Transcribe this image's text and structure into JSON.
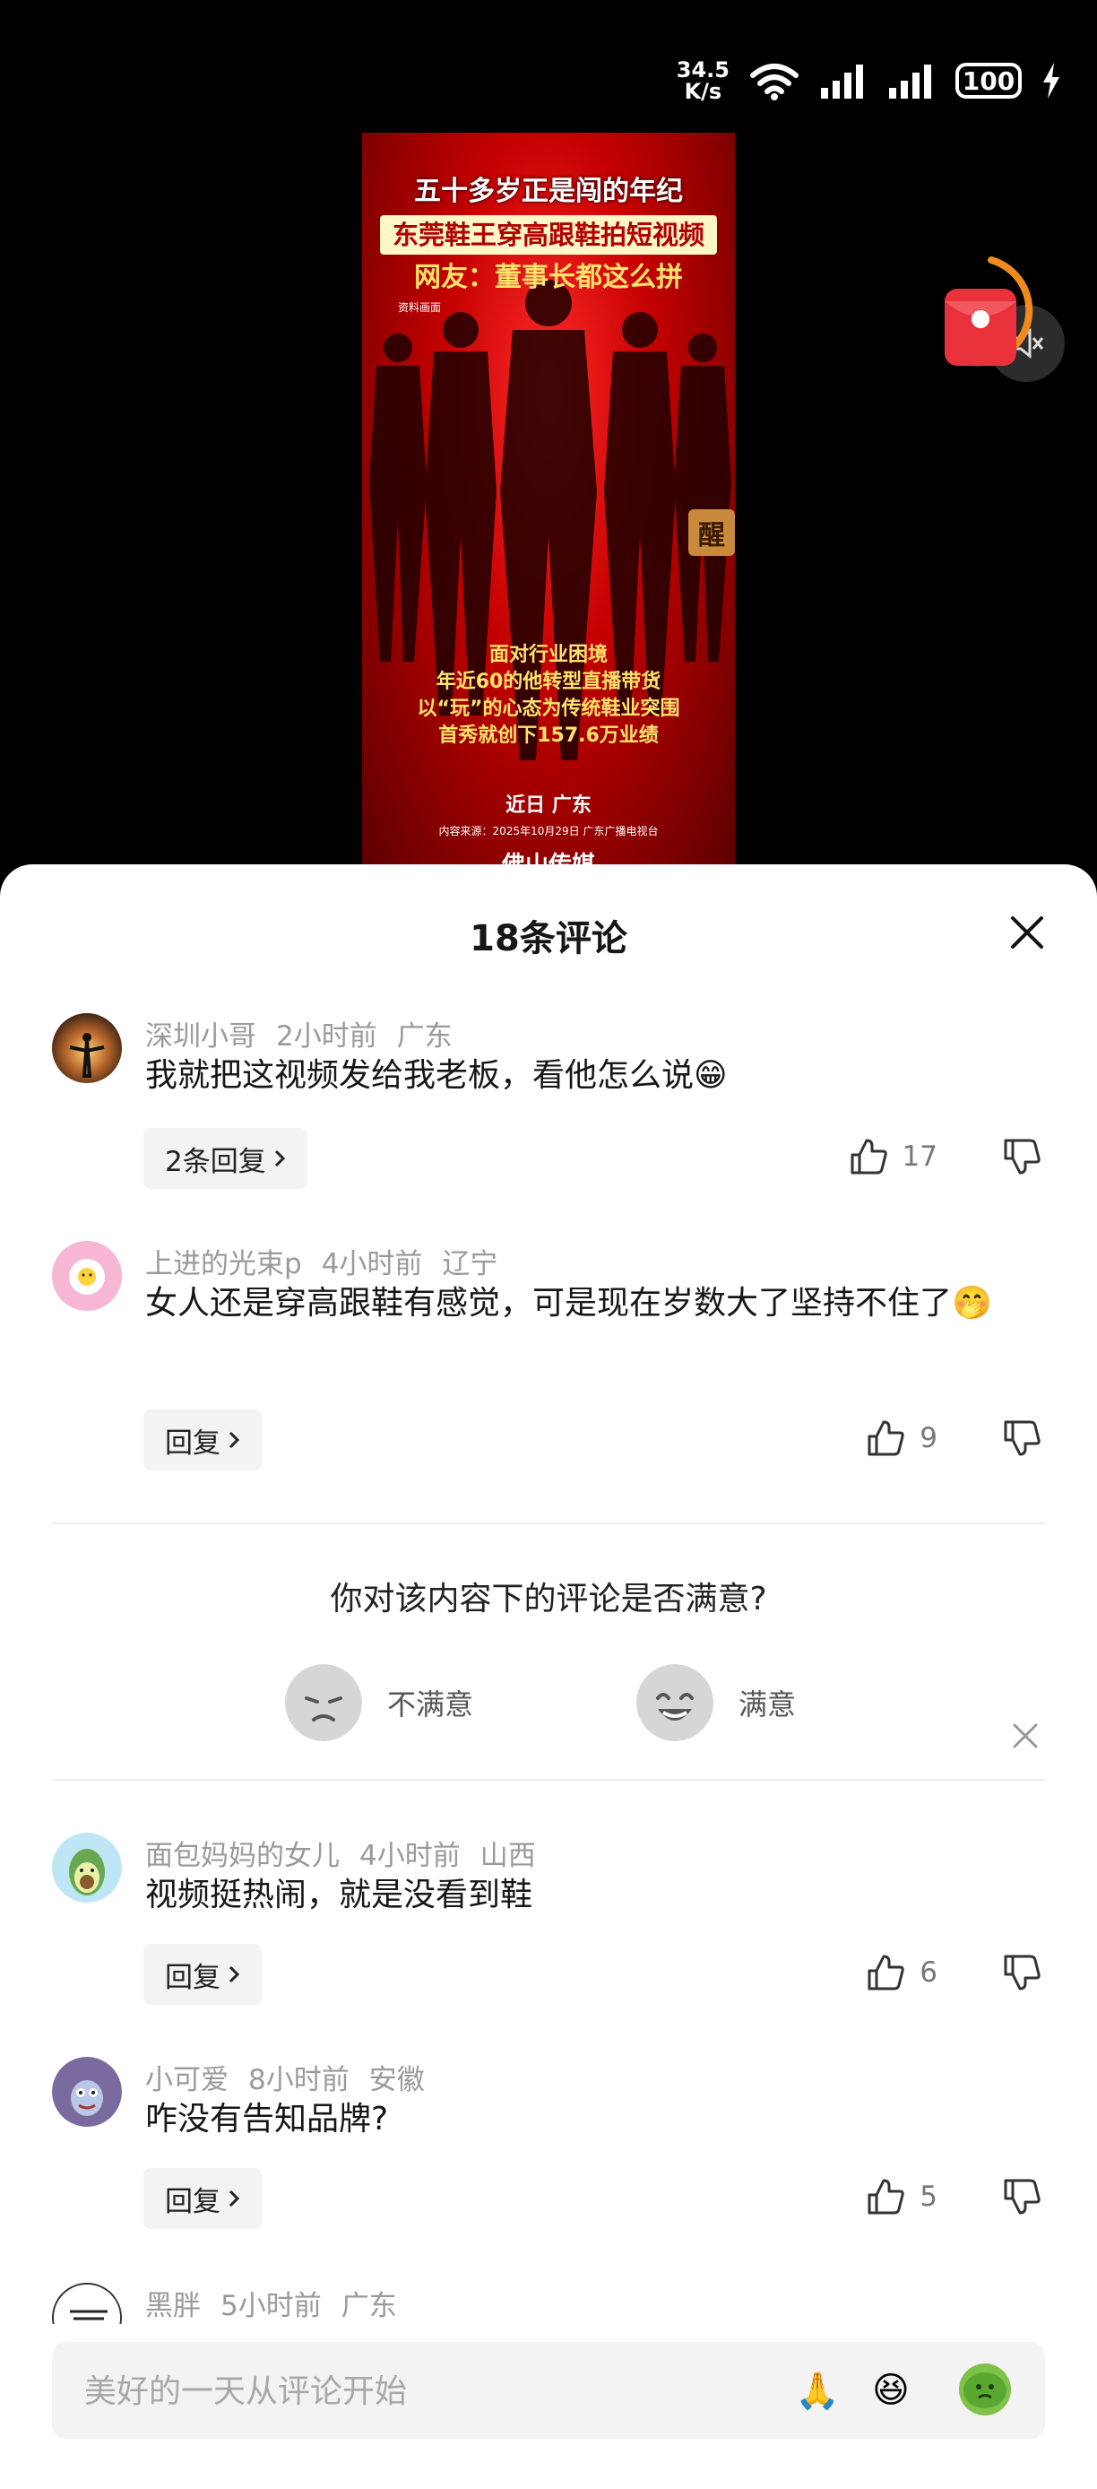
{
  "status_bar": {
    "speed_value": "34.5",
    "speed_unit": "K/s",
    "battery": "100"
  },
  "video": {
    "title_line1": "五十多岁正是闯的年纪",
    "title_line2": "东莞鞋王穿高跟鞋拍短视频",
    "title_line3": "网友：董事长都这么拼",
    "small_caption": "资料画面",
    "sub_lines": [
      "面对行业困境",
      "年近60的他转型直播带货",
      "以“玩”的心态为传统鞋业突围",
      "首秀就创下157.6万业绩"
    ],
    "place": "近日 广东",
    "source": "内容来源：2025年10月29日 广东广播电视台",
    "logo": "佛山传媒",
    "stamp": "醒"
  },
  "sheet": {
    "title": "18条评论"
  },
  "comments": [
    {
      "user": "深圳小哥",
      "time": "2小时前",
      "location": "广东",
      "text": "我就把这视频发给我老板，看他怎么说😁",
      "reply_label": "2条回复",
      "likes": "17"
    },
    {
      "user": "上进的光束p",
      "time": "4小时前",
      "location": "辽宁",
      "text": "女人还是穿高跟鞋有感觉，可是现在岁数大了坚持不住了🤭",
      "reply_label": "回复",
      "likes": "9"
    },
    {
      "user": "面包妈妈的女儿",
      "time": "4小时前",
      "location": "山西",
      "text": "视频挺热闹，就是没看到鞋",
      "reply_label": "回复",
      "likes": "6"
    },
    {
      "user": "小可爱",
      "time": "8小时前",
      "location": "安徽",
      "text": "咋没有告知品牌?",
      "reply_label": "回复",
      "likes": "5"
    },
    {
      "user": "黑胖",
      "time": "5小时前",
      "location": "广东"
    }
  ],
  "survey": {
    "question": "你对该内容下的评论是否满意?",
    "option_bad": "不满意",
    "option_good": "满意"
  },
  "input": {
    "placeholder": "美好的一天从评论开始"
  },
  "colors": {
    "sheet_bg": "#ffffff",
    "meta_gray": "#9a9a9a",
    "video_red": "#c40000"
  }
}
